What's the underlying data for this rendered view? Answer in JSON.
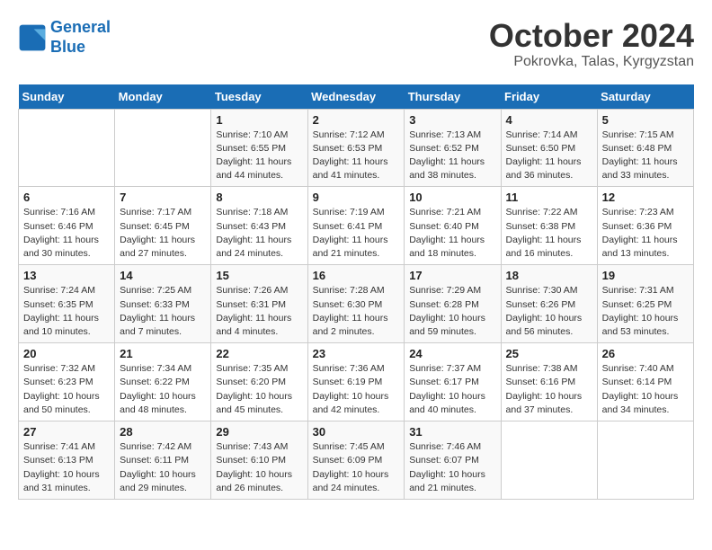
{
  "header": {
    "logo_line1": "General",
    "logo_line2": "Blue",
    "month": "October 2024",
    "location": "Pokrovka, Talas, Kyrgyzstan"
  },
  "weekdays": [
    "Sunday",
    "Monday",
    "Tuesday",
    "Wednesday",
    "Thursday",
    "Friday",
    "Saturday"
  ],
  "weeks": [
    [
      {
        "day": "",
        "info": ""
      },
      {
        "day": "",
        "info": ""
      },
      {
        "day": "1",
        "info": "Sunrise: 7:10 AM\nSunset: 6:55 PM\nDaylight: 11 hours and 44 minutes."
      },
      {
        "day": "2",
        "info": "Sunrise: 7:12 AM\nSunset: 6:53 PM\nDaylight: 11 hours and 41 minutes."
      },
      {
        "day": "3",
        "info": "Sunrise: 7:13 AM\nSunset: 6:52 PM\nDaylight: 11 hours and 38 minutes."
      },
      {
        "day": "4",
        "info": "Sunrise: 7:14 AM\nSunset: 6:50 PM\nDaylight: 11 hours and 36 minutes."
      },
      {
        "day": "5",
        "info": "Sunrise: 7:15 AM\nSunset: 6:48 PM\nDaylight: 11 hours and 33 minutes."
      }
    ],
    [
      {
        "day": "6",
        "info": "Sunrise: 7:16 AM\nSunset: 6:46 PM\nDaylight: 11 hours and 30 minutes."
      },
      {
        "day": "7",
        "info": "Sunrise: 7:17 AM\nSunset: 6:45 PM\nDaylight: 11 hours and 27 minutes."
      },
      {
        "day": "8",
        "info": "Sunrise: 7:18 AM\nSunset: 6:43 PM\nDaylight: 11 hours and 24 minutes."
      },
      {
        "day": "9",
        "info": "Sunrise: 7:19 AM\nSunset: 6:41 PM\nDaylight: 11 hours and 21 minutes."
      },
      {
        "day": "10",
        "info": "Sunrise: 7:21 AM\nSunset: 6:40 PM\nDaylight: 11 hours and 18 minutes."
      },
      {
        "day": "11",
        "info": "Sunrise: 7:22 AM\nSunset: 6:38 PM\nDaylight: 11 hours and 16 minutes."
      },
      {
        "day": "12",
        "info": "Sunrise: 7:23 AM\nSunset: 6:36 PM\nDaylight: 11 hours and 13 minutes."
      }
    ],
    [
      {
        "day": "13",
        "info": "Sunrise: 7:24 AM\nSunset: 6:35 PM\nDaylight: 11 hours and 10 minutes."
      },
      {
        "day": "14",
        "info": "Sunrise: 7:25 AM\nSunset: 6:33 PM\nDaylight: 11 hours and 7 minutes."
      },
      {
        "day": "15",
        "info": "Sunrise: 7:26 AM\nSunset: 6:31 PM\nDaylight: 11 hours and 4 minutes."
      },
      {
        "day": "16",
        "info": "Sunrise: 7:28 AM\nSunset: 6:30 PM\nDaylight: 11 hours and 2 minutes."
      },
      {
        "day": "17",
        "info": "Sunrise: 7:29 AM\nSunset: 6:28 PM\nDaylight: 10 hours and 59 minutes."
      },
      {
        "day": "18",
        "info": "Sunrise: 7:30 AM\nSunset: 6:26 PM\nDaylight: 10 hours and 56 minutes."
      },
      {
        "day": "19",
        "info": "Sunrise: 7:31 AM\nSunset: 6:25 PM\nDaylight: 10 hours and 53 minutes."
      }
    ],
    [
      {
        "day": "20",
        "info": "Sunrise: 7:32 AM\nSunset: 6:23 PM\nDaylight: 10 hours and 50 minutes."
      },
      {
        "day": "21",
        "info": "Sunrise: 7:34 AM\nSunset: 6:22 PM\nDaylight: 10 hours and 48 minutes."
      },
      {
        "day": "22",
        "info": "Sunrise: 7:35 AM\nSunset: 6:20 PM\nDaylight: 10 hours and 45 minutes."
      },
      {
        "day": "23",
        "info": "Sunrise: 7:36 AM\nSunset: 6:19 PM\nDaylight: 10 hours and 42 minutes."
      },
      {
        "day": "24",
        "info": "Sunrise: 7:37 AM\nSunset: 6:17 PM\nDaylight: 10 hours and 40 minutes."
      },
      {
        "day": "25",
        "info": "Sunrise: 7:38 AM\nSunset: 6:16 PM\nDaylight: 10 hours and 37 minutes."
      },
      {
        "day": "26",
        "info": "Sunrise: 7:40 AM\nSunset: 6:14 PM\nDaylight: 10 hours and 34 minutes."
      }
    ],
    [
      {
        "day": "27",
        "info": "Sunrise: 7:41 AM\nSunset: 6:13 PM\nDaylight: 10 hours and 31 minutes."
      },
      {
        "day": "28",
        "info": "Sunrise: 7:42 AM\nSunset: 6:11 PM\nDaylight: 10 hours and 29 minutes."
      },
      {
        "day": "29",
        "info": "Sunrise: 7:43 AM\nSunset: 6:10 PM\nDaylight: 10 hours and 26 minutes."
      },
      {
        "day": "30",
        "info": "Sunrise: 7:45 AM\nSunset: 6:09 PM\nDaylight: 10 hours and 24 minutes."
      },
      {
        "day": "31",
        "info": "Sunrise: 7:46 AM\nSunset: 6:07 PM\nDaylight: 10 hours and 21 minutes."
      },
      {
        "day": "",
        "info": ""
      },
      {
        "day": "",
        "info": ""
      }
    ]
  ]
}
